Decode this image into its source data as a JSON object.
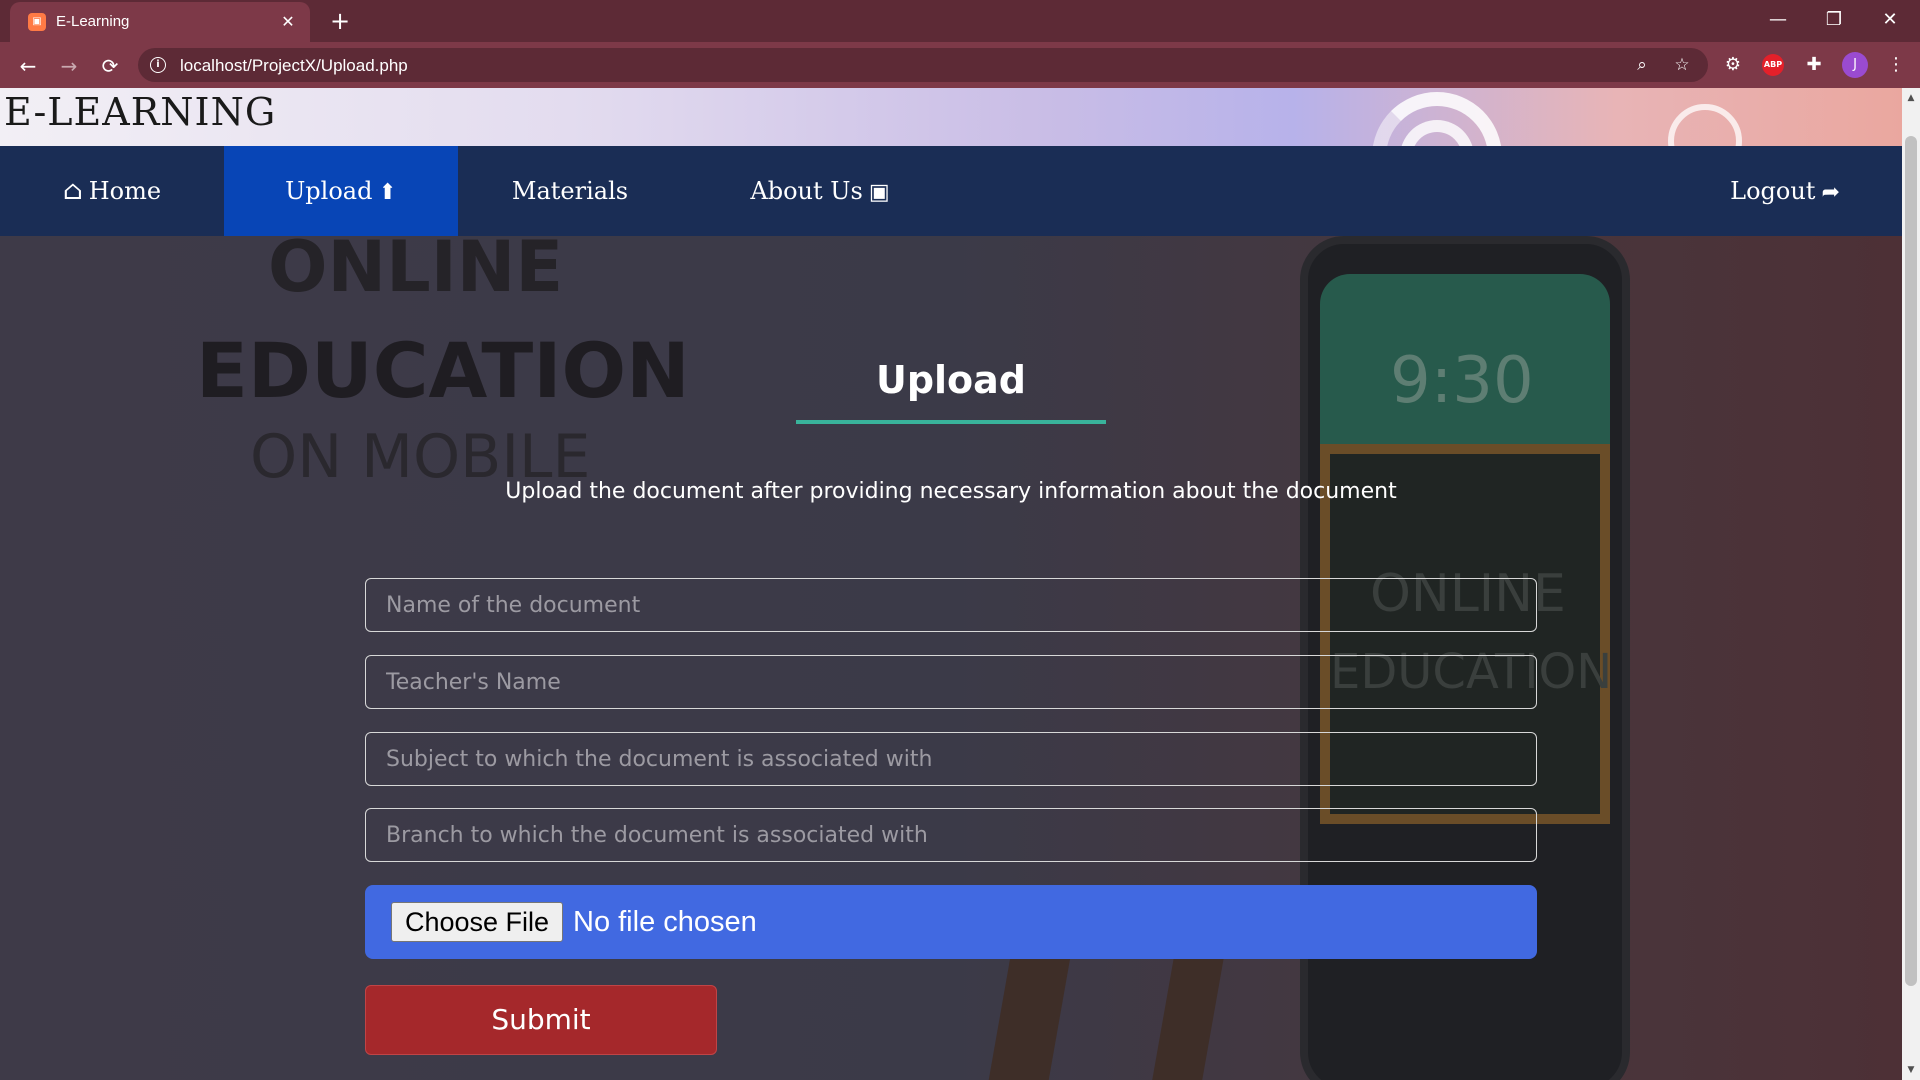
{
  "browser": {
    "tab_title": "E-Learning",
    "tab_close": "✕",
    "new_tab": "+",
    "url": "localhost/ProjectX/Upload.php",
    "avatar_letter": "J",
    "abp_label": "ABP",
    "window_controls": {
      "minimize": "—",
      "restore": "❐",
      "close": "✕"
    },
    "nav": {
      "back": "←",
      "forward": "→",
      "reload": "⟳"
    }
  },
  "header": {
    "brand": "E-LEARNING"
  },
  "navbar": {
    "items": [
      {
        "label": "Home",
        "icon": "home-icon",
        "glyph": "⌂",
        "active": false
      },
      {
        "label": "Upload",
        "icon": "upload-icon",
        "glyph": "⬆",
        "active": true
      },
      {
        "label": "Materials",
        "icon": "",
        "glyph": "",
        "active": false
      },
      {
        "label": "About Us",
        "icon": "contact-card-icon",
        "glyph": "▣",
        "active": false
      },
      {
        "label": "Logout",
        "icon": "logout-icon",
        "glyph": "➦",
        "active": false
      }
    ]
  },
  "background": {
    "line1": "ONLINE",
    "line2": "EDUCATION",
    "line3": "ON MOBILE",
    "phone_time": "9:30",
    "board_line1": "ONLINE",
    "board_line2": "EDUCATION"
  },
  "form": {
    "title": "Upload",
    "subtitle": "Upload the document after providing necessary information about the document",
    "fields": {
      "doc_name_placeholder": "Name of the document",
      "teacher_placeholder": "Teacher's Name",
      "subject_placeholder": "Subject to which the document is associated with",
      "branch_placeholder": "Branch to which the document is associated with"
    },
    "file_button": "Choose File",
    "file_status": "No file chosen",
    "submit": "Submit"
  },
  "colors": {
    "nav_bg": "#1a2d55",
    "nav_active": "#0845b6",
    "file_box": "#4169e1",
    "submit": "#a5282b",
    "accent_rule": "#39b39b"
  }
}
